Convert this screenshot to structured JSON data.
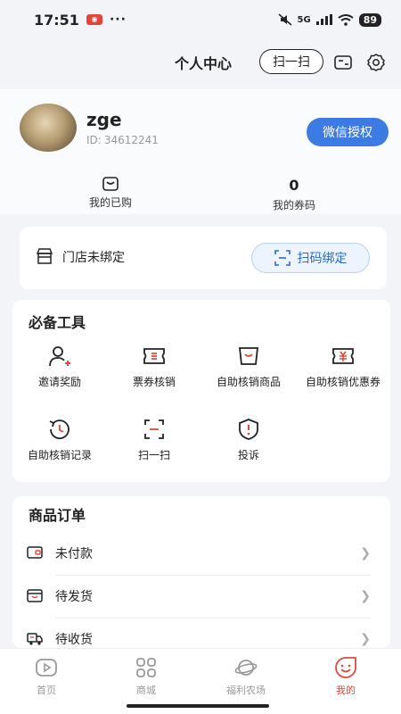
{
  "status_bar": {
    "time": "17:51",
    "battery": "89",
    "network": "5G"
  },
  "header": {
    "title": "个人中心",
    "scan_label": "扫一扫"
  },
  "profile": {
    "username": "zge",
    "id_prefix": "ID:",
    "id_value": "34612241",
    "wechat_button": "微信授权",
    "stats": [
      {
        "value": "",
        "label": "我的已购"
      },
      {
        "value": "0",
        "label": "我的券码"
      }
    ]
  },
  "store": {
    "label": "门店未绑定",
    "bind_button": "扫码绑定"
  },
  "tools": {
    "title": "必备工具",
    "items": [
      {
        "label": "邀请奖励",
        "icon": "invite-icon"
      },
      {
        "label": "票券核销",
        "icon": "ticket-icon"
      },
      {
        "label": "自助核销商品",
        "icon": "product-icon"
      },
      {
        "label": "自助核销优惠券",
        "icon": "coupon-icon"
      },
      {
        "label": "自助核销记录",
        "icon": "history-icon"
      },
      {
        "label": "扫一扫",
        "icon": "scan-icon"
      },
      {
        "label": "投诉",
        "icon": "complaint-icon"
      }
    ]
  },
  "orders": {
    "title": "商品订单",
    "items": [
      {
        "label": "未付款",
        "icon": "wallet-icon"
      },
      {
        "label": "待发货",
        "icon": "box-icon"
      },
      {
        "label": "待收货",
        "icon": "truck-icon"
      }
    ]
  },
  "tabbar": {
    "items": [
      {
        "label": "首页",
        "icon": "play-icon"
      },
      {
        "label": "商城",
        "icon": "grid-icon"
      },
      {
        "label": "福利农场",
        "icon": "planet-icon"
      },
      {
        "label": "我的",
        "icon": "smile-icon"
      }
    ],
    "active_color": "#e0483d",
    "inactive_color": "#999999"
  },
  "colors": {
    "accent": "#3c7be4",
    "brand_red": "#e0483d"
  }
}
